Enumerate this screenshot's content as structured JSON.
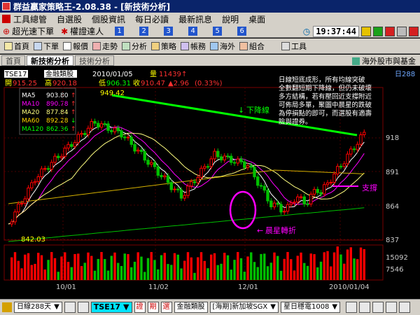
{
  "window": {
    "title": "群益贏家策略王-2.08.38 - [新技術分析]"
  },
  "menu": {
    "items": [
      "工具總管",
      "自選股",
      "個股資訊",
      "每日必讀",
      "最新訊息",
      "說明",
      "桌面"
    ]
  },
  "quickbar": {
    "items": [
      "超光速下單",
      "權證達人"
    ],
    "numbers": [
      "1",
      "2",
      "3",
      "4",
      "5",
      "6"
    ],
    "clock": "19:37:44"
  },
  "toolbar": {
    "items": [
      "首頁",
      "下單",
      "報價",
      "走勢",
      "分析",
      "策略",
      "帳務",
      "海外",
      "組合",
      "工具"
    ]
  },
  "tabs": {
    "items": [
      "首頁",
      "新技術分析",
      "技術分析"
    ],
    "right": "海外股市與基金"
  },
  "chart": {
    "symbol": "TSE17",
    "name": "金融類股",
    "date": "2010/01/05",
    "vol_label": "量",
    "vol_value": "11439",
    "open_label": "開",
    "open": "915.25",
    "high_label": "高",
    "high": "920.18",
    "low_label": "低",
    "low": "906.31",
    "close_label": "收",
    "close": "910.47",
    "change": "▲2.96",
    "pct": "(0.33%)",
    "period_tag": "日288",
    "ma": [
      {
        "label": "MA5",
        "value": "903.80",
        "arrow": "↑",
        "color": "#ffffff"
      },
      {
        "label": "MA10",
        "value": "890.78",
        "arrow": "↑",
        "color": "#ff00ff"
      },
      {
        "label": "MA20",
        "value": "877.84",
        "arrow": "↑",
        "color": "#ffff80"
      },
      {
        "label": "MA60",
        "value": "892.28",
        "arrow": "↓",
        "color": "#ffd700"
      },
      {
        "label": "MA120",
        "value": "862.36",
        "arrow": "↑",
        "color": "#00ff00"
      }
    ],
    "price_ticks": [
      "918",
      "891",
      "864",
      "837"
    ],
    "vol_ticks": [
      "15092",
      "7546"
    ],
    "date_ticks": [
      "10/01",
      "11/02",
      "12/01",
      "2010/01/04"
    ],
    "high_mark": "949.42",
    "low_mark": "842.03",
    "annotation": "日線短底成形，所有均線突破\n全數翻短期下降線，但仍未破壞\n多方結構，若有壓回近支撐附近\n可佈局多單，聚圖中晨星的跌破\n為停損點的即可，而選股有適壽\n險與證券。",
    "label_downtrend": "下降線",
    "label_support": "支撐",
    "label_morning_star": "晨星轉折",
    "colors": {
      "up": "#ff0000",
      "down": "#00c000",
      "downtrend": "#00ff00",
      "accent": "#ff00ff"
    }
  },
  "bottombar": {
    "period": "日線288天",
    "symbol": "TSE17",
    "btn_a": "證",
    "btn_b": "期",
    "btn_c": "選",
    "name": "金融類股",
    "combo1": "[海期]新加坡SGX",
    "combo2": "星日穩電1008"
  }
}
